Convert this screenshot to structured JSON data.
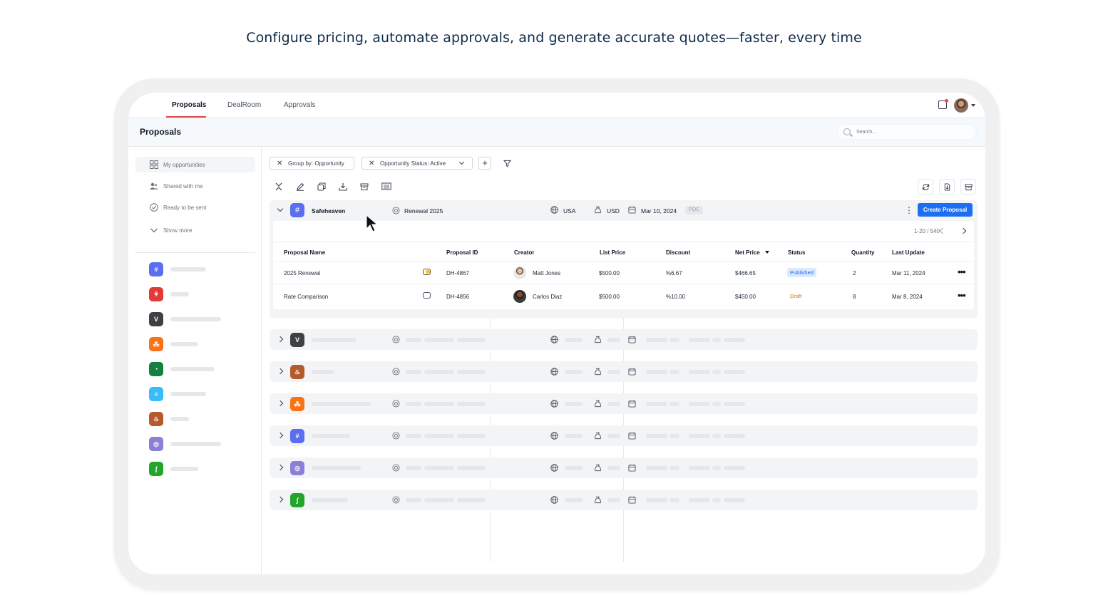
{
  "headline": "Configure pricing, automate approvals, and generate accurate quotes—faster, every time",
  "topnav": {
    "tabs": [
      "Proposals",
      "DealRoom",
      "Approvals"
    ]
  },
  "page": {
    "title": "Proposals",
    "search_placeholder": "Search..."
  },
  "sidebar": {
    "items": [
      {
        "label": "My opportunities",
        "icon": "grid-icon"
      },
      {
        "label": "Shared with me",
        "icon": "users-icon"
      },
      {
        "label": "Ready to be sent",
        "icon": "check-circle-icon"
      },
      {
        "label": "Show more",
        "icon": "chevron-down-icon"
      }
    ],
    "apps": [
      {
        "color": "#5b6ef0",
        "glyph": "#"
      },
      {
        "color": "#e53935",
        "glyph": "⚘"
      },
      {
        "color": "#3f3f46",
        "glyph": "V"
      },
      {
        "color": "#f97316",
        "glyph": "⁂"
      },
      {
        "color": "#15803d",
        "glyph": "◔"
      },
      {
        "color": "#38bdf8",
        "glyph": "≡"
      },
      {
        "color": "#b45a2b",
        "glyph": "♨"
      },
      {
        "color": "#8b7fd6",
        "glyph": "◎"
      },
      {
        "color": "#22a52a",
        "glyph": "∫"
      }
    ]
  },
  "filters": {
    "group_by": "Group by: Opportunity",
    "status": "Opportunity Status: Active"
  },
  "group": {
    "name": "Safeheaven",
    "opportunity": "Renewal 2025",
    "country": "USA",
    "currency": "USD",
    "date": "Mar 10, 2024",
    "tag": "POC",
    "create_label": "Create Proposal",
    "pager": "1-20 / 540",
    "columns": [
      "Proposal Name",
      "Proposal ID",
      "Creator",
      "List Price",
      "Discount",
      "Net Price",
      "Status",
      "Quantity",
      "Last Update"
    ],
    "rows": [
      {
        "name": "2025 Renewal",
        "id": "DH-4867",
        "creator": "Matt Jones",
        "list_price": "$500.00",
        "discount": "%6.67",
        "net_price": "$466.65",
        "status": "Published",
        "quantity": "2",
        "last_update": "Mar 11, 2024"
      },
      {
        "name": "Rate Comparison",
        "id": "DH-4856",
        "creator": "Carlos Diaz",
        "list_price": "$500.00",
        "discount": "%10.00",
        "net_price": "$450.00",
        "status": "Draft",
        "quantity": "8",
        "last_update": "Mar 8, 2024"
      }
    ]
  },
  "collapsed_groups": [
    {
      "color": "#3f3f46",
      "glyph": "V"
    },
    {
      "color": "#b45a2b",
      "glyph": "♨"
    },
    {
      "color": "#f97316",
      "glyph": "⁂"
    },
    {
      "color": "#5b6ef0",
      "glyph": "#"
    },
    {
      "color": "#8b7fd6",
      "glyph": "◎"
    },
    {
      "color": "#22a52a",
      "glyph": "∫"
    }
  ],
  "colors": {
    "accent": "#1d6ff2",
    "tab_indicator": "#e04a4a",
    "published": "#2563eb",
    "draft": "#d97706"
  }
}
